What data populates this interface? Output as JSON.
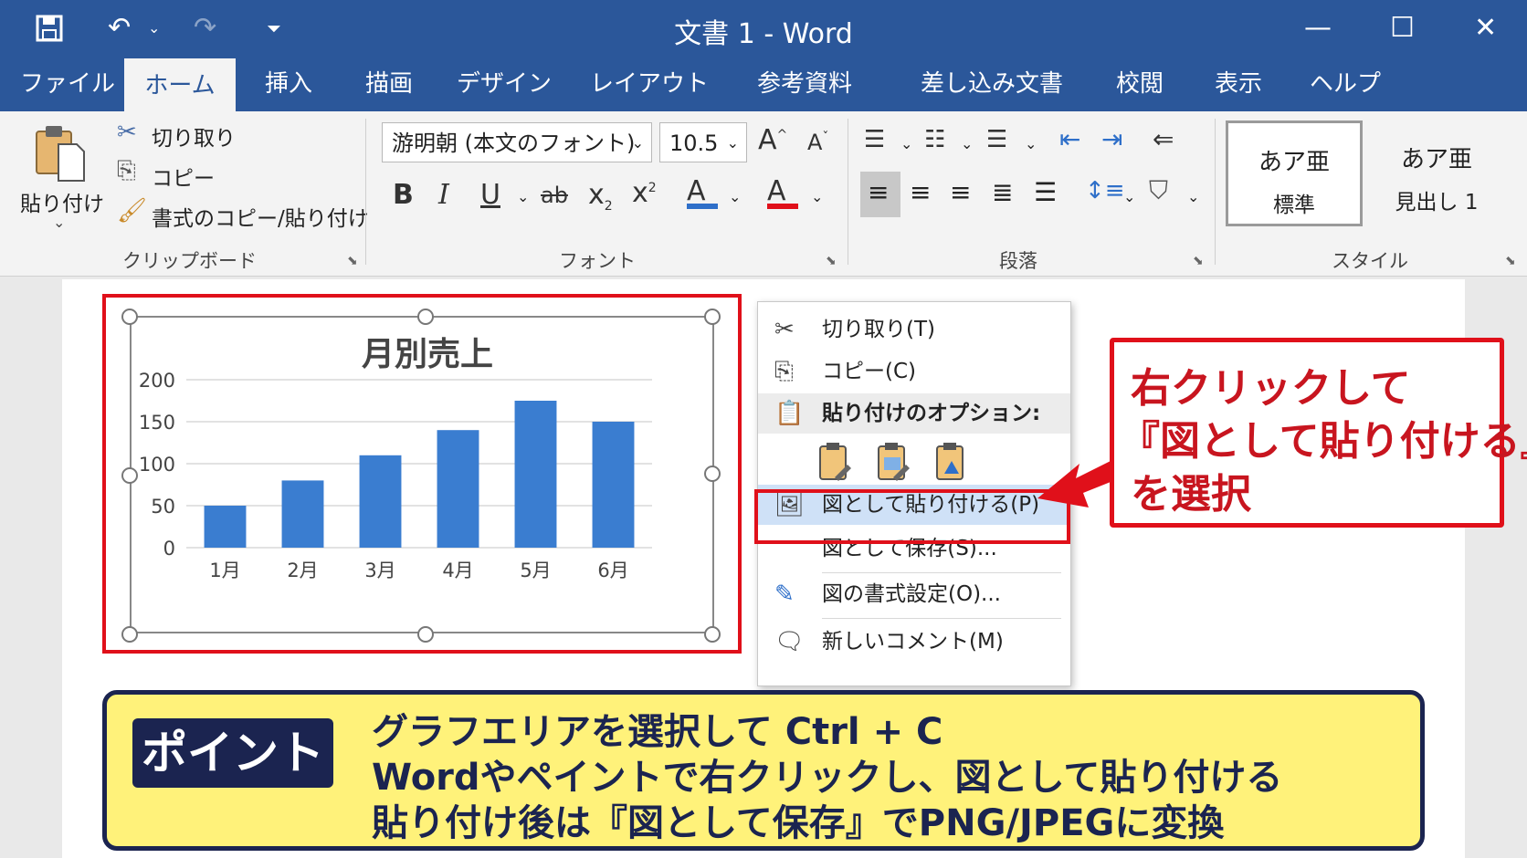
{
  "window": {
    "title": "文書 1  -  Word"
  },
  "tabs": [
    "ファイル",
    "ホーム",
    "挿入",
    "描画",
    "デザイン",
    "レイアウト",
    "参考資料",
    "差し込み文書",
    "校閲",
    "表示",
    "ヘルプ"
  ],
  "active_tab": "ホーム",
  "clipboard": {
    "paste": "貼り付け",
    "cut": "切り取り",
    "copy": "コピー",
    "format_painter": "書式のコピー/貼り付け",
    "group": "クリップボード"
  },
  "font": {
    "name": "游明朝 (本文のフォント)",
    "size": "10.5",
    "group": "フォント"
  },
  "paragraph": {
    "group": "段落"
  },
  "styles": {
    "items": [
      {
        "preview": "あア亜",
        "label": "標準"
      },
      {
        "preview": "あア亜",
        "label": "見出し 1"
      }
    ],
    "group": "スタイル"
  },
  "chart_data": {
    "type": "bar",
    "title": "月別売上",
    "categories": [
      "1月",
      "2月",
      "3月",
      "4月",
      "5月",
      "6月"
    ],
    "values": [
      50,
      80,
      110,
      140,
      175,
      150
    ],
    "ylim": [
      0,
      200
    ],
    "yticks": [
      "0",
      "50",
      "100",
      "150",
      "200"
    ],
    "color": "#3a7dd0",
    "grid": true
  },
  "context_menu": {
    "cut": "切り取り(T)",
    "copy": "コピー(C)",
    "paste_options": "貼り付けのオプション:",
    "paste_as_picture": "図として貼り付ける(P)",
    "save_as_picture": "図として保存(S)...",
    "format_picture": "図の書式設定(O)...",
    "new_comment": "新しいコメント(M)"
  },
  "callout": {
    "lines": [
      "右クリックして",
      "『図として貼り付ける』",
      "を選択"
    ]
  },
  "point": {
    "badge": "ポイント",
    "lines": [
      "グラフエリアを選択して Ctrl + C",
      "Wordやペイントで右クリックし、図として貼り付ける",
      "貼り付け後は『図として保存』でPNG/JPEGに変換"
    ]
  },
  "colors": {
    "word_blue": "#2b579a",
    "highlight_red": "#e0101a",
    "point_yellow": "#fff27a",
    "point_navy": "#1b2450"
  }
}
